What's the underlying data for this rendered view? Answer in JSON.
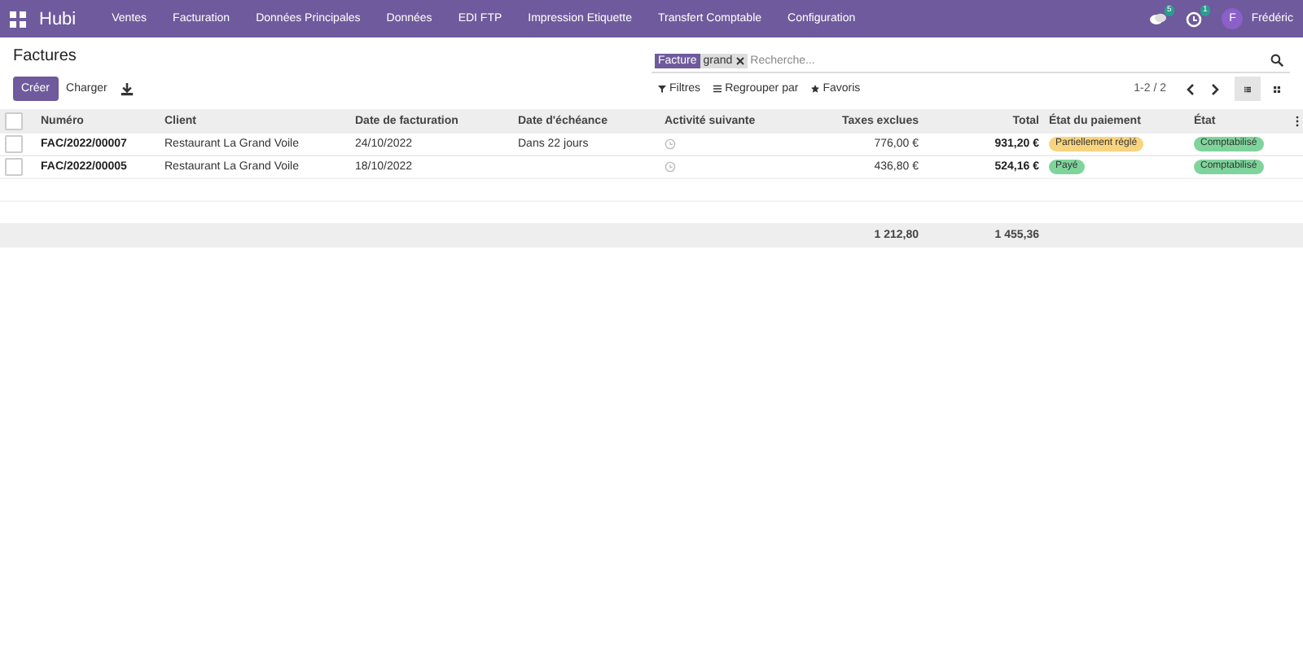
{
  "navbar": {
    "app_name": "Hubi",
    "menu": [
      "Ventes",
      "Facturation",
      "Données Principales",
      "Données",
      "EDI FTP",
      "Impression Etiquette",
      "Transfert Comptable",
      "Configuration"
    ],
    "messages_count": "5",
    "activities_count": "1",
    "user": {
      "initial": "F",
      "name": "Frédéric"
    }
  },
  "page_title": "Factures",
  "actions": {
    "create": "Créer",
    "upload": "Charger"
  },
  "search": {
    "facet_label": "Facture",
    "facet_value": "grand",
    "placeholder": "Recherche..."
  },
  "filters": [
    "Filtres",
    "Regrouper par",
    "Favoris"
  ],
  "pager": "1-2 / 2",
  "views": [
    {
      "kind": "list",
      "selected": true
    },
    {
      "kind": "kanban",
      "selected": false
    }
  ],
  "table": {
    "all_checked": false,
    "columns": [
      "Numéro",
      "Client",
      "Date de facturation",
      "Date d'échéance",
      "Activité suivante",
      "Taxes exclues",
      "Total",
      "État du paiement",
      "État"
    ],
    "rows": [
      {
        "number": "FAC/2022/00007",
        "client": "Restaurant La Grand Voile",
        "invoice_date": "24/10/2022",
        "due": "Dans 22 jours",
        "untaxed": "776,00 €",
        "total": "931,20 €",
        "payment": {
          "label": "Partiellement réglé",
          "color": "#f9d47e"
        },
        "state": {
          "label": "Comptabilisé",
          "color": "#7fd49b"
        },
        "checked": false
      },
      {
        "number": "FAC/2022/00005",
        "client": "Restaurant La Grand Voile",
        "invoice_date": "18/10/2022",
        "untaxed": "436,80 €",
        "total": "524,16 €",
        "payment": {
          "label": "Payé",
          "color": "#7fd49b"
        },
        "state": {
          "label": "Comptabilisé",
          "color": "#7fd49b"
        },
        "checked": false
      }
    ],
    "totals": {
      "untaxed": "1 212,80",
      "total": "1 455,36"
    }
  }
}
